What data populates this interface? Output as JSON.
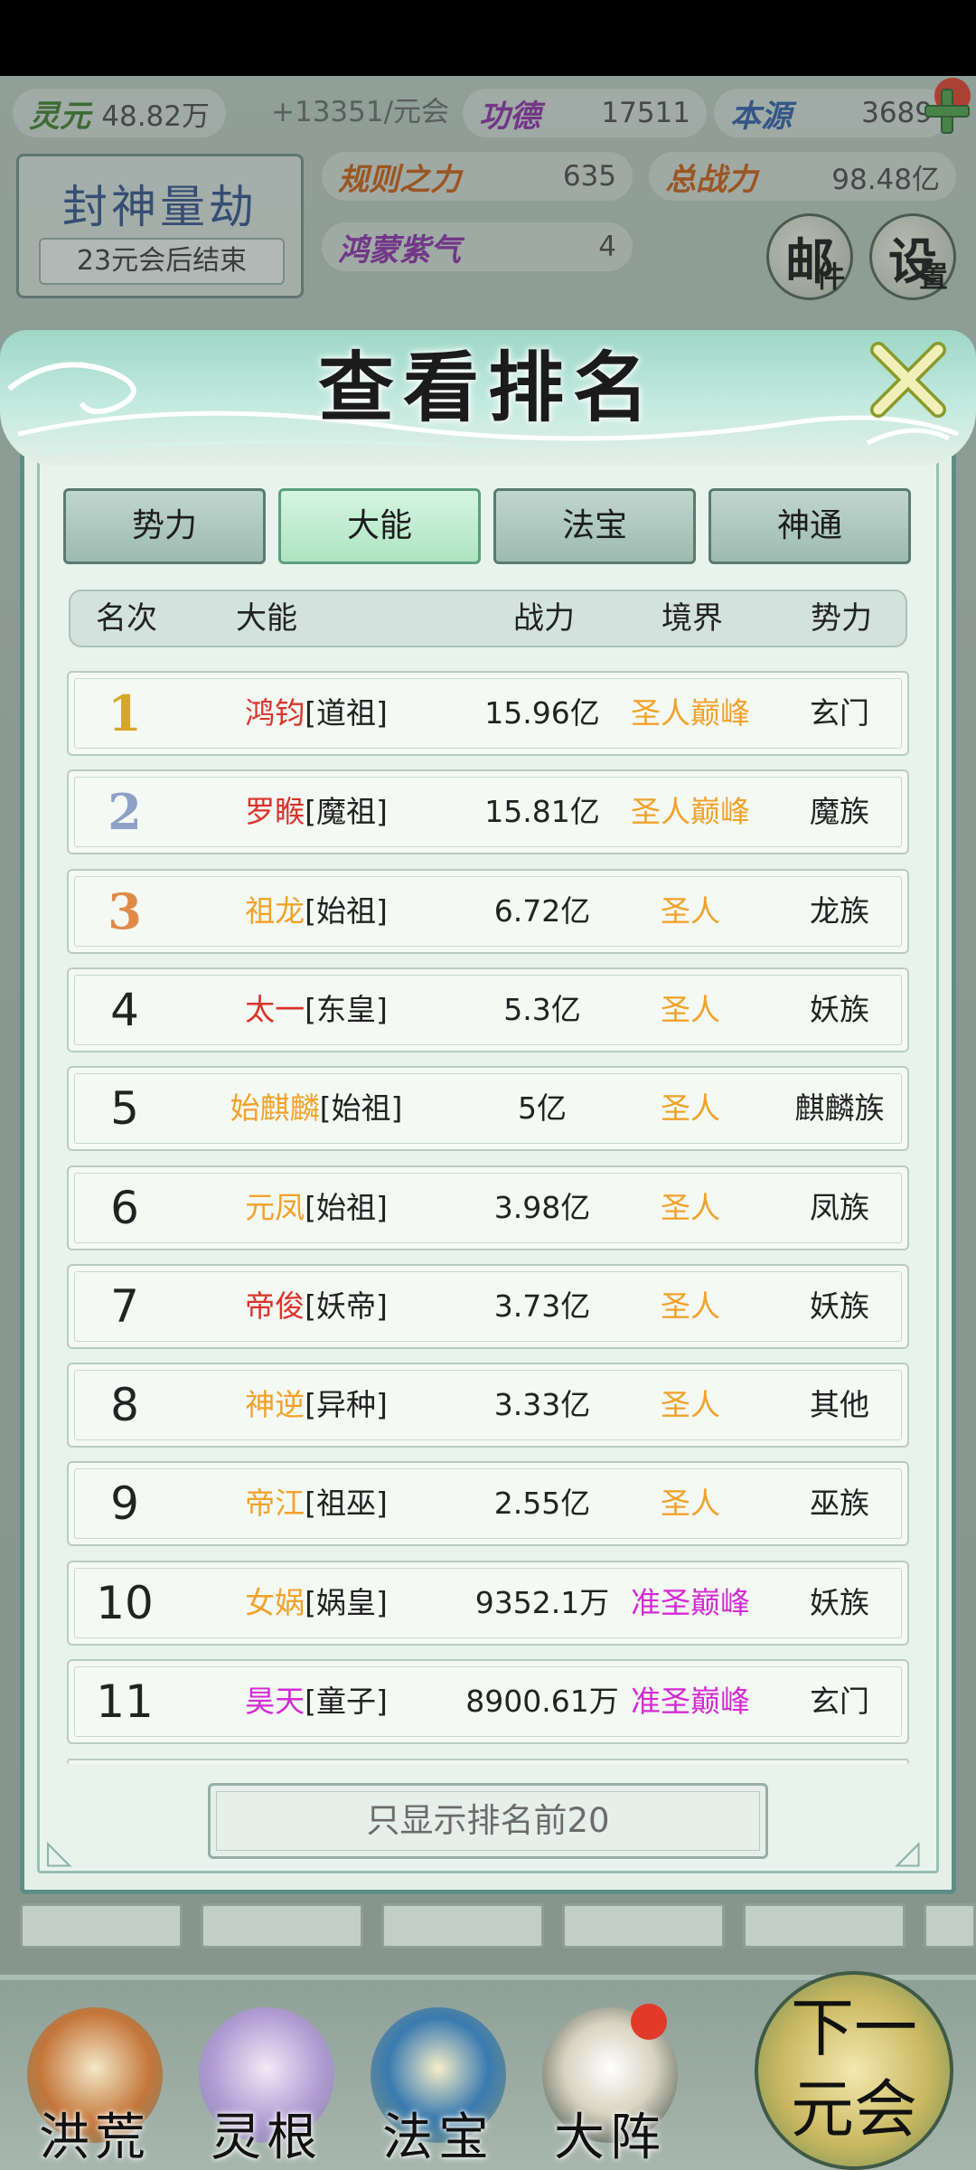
{
  "topbar": {
    "lingyuan_label": "灵元",
    "lingyuan_value": "48.82万",
    "income": "+13351/元会",
    "gongde_label": "功德",
    "gongde_value": "17511",
    "benyuan_label": "本源",
    "benyuan_value": "3689",
    "guize_label": "规则之力",
    "guize_value": "635",
    "zongzhanli_label": "总战力",
    "zongzhanli_value": "98.48亿",
    "hongmeng_label": "鸿蒙紫气",
    "hongmeng_value": "4"
  },
  "event": {
    "title": "封神量劫",
    "subtitle": "23元会后结束"
  },
  "buttons": {
    "mail_main": "邮",
    "mail_small": "件",
    "settings_main": "设",
    "settings_small": "置"
  },
  "modal": {
    "title": "查看排名",
    "tabs": [
      "势力",
      "大能",
      "法宝",
      "神通"
    ],
    "active_tab": "大能",
    "columns": [
      "名次",
      "大能",
      "战力",
      "境界",
      "势力"
    ],
    "footer_button": "只显示排名前20"
  },
  "rankings": [
    {
      "rank": "1",
      "name": "鸿钧",
      "title": "[道祖]",
      "power": "15.96亿",
      "realm": "圣人巅峰",
      "faction": "玄门",
      "name_color": "#d9332a",
      "realm_color": "#f2a22a",
      "rank_color": "#d7a52a"
    },
    {
      "rank": "2",
      "name": "罗睺",
      "title": "[魔祖]",
      "power": "15.81亿",
      "realm": "圣人巅峰",
      "faction": "魔族",
      "name_color": "#d9332a",
      "realm_color": "#f2a22a",
      "rank_color": "#8fa0c8"
    },
    {
      "rank": "3",
      "name": "祖龙",
      "title": "[始祖]",
      "power": "6.72亿",
      "realm": "圣人",
      "faction": "龙族",
      "name_color": "#f2a22a",
      "realm_color": "#f2a22a",
      "rank_color": "#e08a4a"
    },
    {
      "rank": "4",
      "name": "太一",
      "title": "[东皇]",
      "power": "5.3亿",
      "realm": "圣人",
      "faction": "妖族",
      "name_color": "#d9332a",
      "realm_color": "#f2a22a",
      "rank_color": "#222222"
    },
    {
      "rank": "5",
      "name": "始麒麟",
      "title": "[始祖]",
      "power": "5亿",
      "realm": "圣人",
      "faction": "麒麟族",
      "name_color": "#f2a22a",
      "realm_color": "#f2a22a",
      "rank_color": "#222222"
    },
    {
      "rank": "6",
      "name": "元凤",
      "title": "[始祖]",
      "power": "3.98亿",
      "realm": "圣人",
      "faction": "凤族",
      "name_color": "#f2a22a",
      "realm_color": "#f2a22a",
      "rank_color": "#222222"
    },
    {
      "rank": "7",
      "name": "帝俊",
      "title": "[妖帝]",
      "power": "3.73亿",
      "realm": "圣人",
      "faction": "妖族",
      "name_color": "#d9332a",
      "realm_color": "#f2a22a",
      "rank_color": "#222222"
    },
    {
      "rank": "8",
      "name": "神逆",
      "title": "[异种]",
      "power": "3.33亿",
      "realm": "圣人",
      "faction": "其他",
      "name_color": "#f2a22a",
      "realm_color": "#f2a22a",
      "rank_color": "#222222"
    },
    {
      "rank": "9",
      "name": "帝江",
      "title": "[祖巫]",
      "power": "2.55亿",
      "realm": "圣人",
      "faction": "巫族",
      "name_color": "#f2a22a",
      "realm_color": "#f2a22a",
      "rank_color": "#222222"
    },
    {
      "rank": "10",
      "name": "女娲",
      "title": "[娲皇]",
      "power": "9352.1万",
      "realm": "准圣巅峰",
      "faction": "妖族",
      "name_color": "#f2a22a",
      "realm_color": "#d42ad4",
      "rank_color": "#222222"
    },
    {
      "rank": "11",
      "name": "昊天",
      "title": "[童子]",
      "power": "8900.61万",
      "realm": "准圣巅峰",
      "faction": "玄门",
      "name_color": "#d42ad4",
      "realm_color": "#d42ad4",
      "rank_color": "#222222"
    }
  ],
  "bottom_nav": [
    "洪荒",
    "灵根",
    "法宝",
    "大阵"
  ],
  "next_button": [
    "下一",
    "元会"
  ]
}
